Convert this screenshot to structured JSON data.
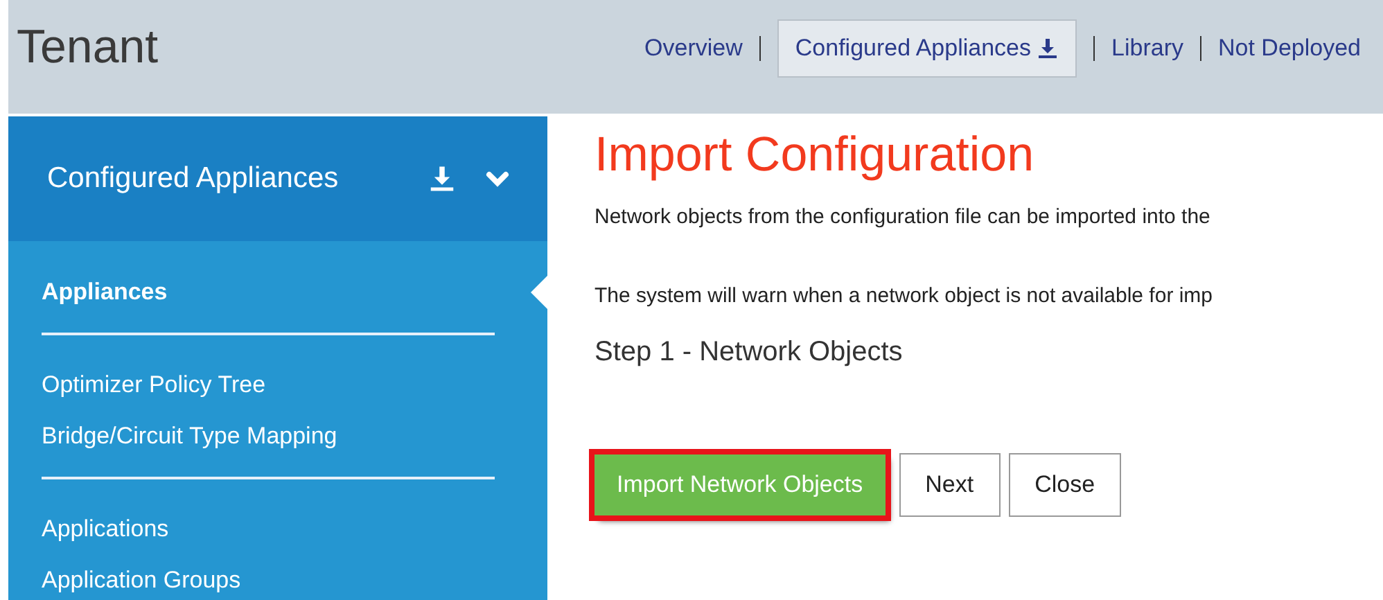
{
  "header": {
    "title": "Tenant"
  },
  "nav": [
    {
      "label": "Overview",
      "selected": false,
      "icon": false
    },
    {
      "label": "Configured Appliances",
      "selected": true,
      "icon": true
    },
    {
      "label": "Library",
      "selected": false,
      "icon": false
    },
    {
      "label": "Not Deployed",
      "selected": false,
      "icon": false
    }
  ],
  "sidebar": {
    "title": "Configured Appliances",
    "expanded": true,
    "groups": [
      {
        "items": [
          {
            "label": "Appliances",
            "selected": true
          }
        ]
      },
      {
        "items": [
          {
            "label": "Optimizer Policy Tree",
            "selected": false
          },
          {
            "label": "Bridge/Circuit Type Mapping",
            "selected": false
          }
        ]
      },
      {
        "items": [
          {
            "label": "Applications",
            "selected": false
          },
          {
            "label": "Application Groups",
            "selected": false
          }
        ]
      }
    ]
  },
  "main": {
    "title": "Import Configuration",
    "paragraphs": [
      "Network objects from the configuration file can be imported into the",
      "The system will warn when a network object is not available for imp"
    ],
    "step": "Step 1 - Network Objects",
    "buttons": [
      {
        "label": "Import Network Objects",
        "kind": "primary",
        "highlighted": true
      },
      {
        "label": "Next",
        "kind": "secondary",
        "highlighted": false
      },
      {
        "label": "Close",
        "kind": "secondary",
        "highlighted": false
      }
    ]
  }
}
